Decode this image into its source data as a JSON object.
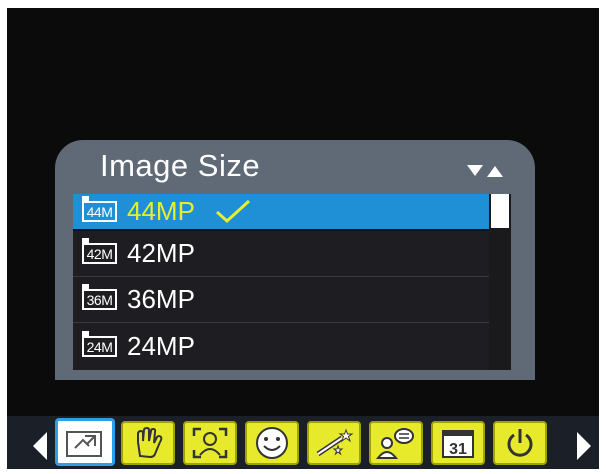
{
  "menu": {
    "title": "Image Size",
    "options": [
      {
        "badge": "44M",
        "label": "44MP",
        "selected": true
      },
      {
        "badge": "42M",
        "label": "42MP",
        "selected": false
      },
      {
        "badge": "36M",
        "label": "36MP",
        "selected": false
      },
      {
        "badge": "24M",
        "label": "24MP",
        "selected": false
      }
    ]
  },
  "toolbar": {
    "items": [
      {
        "icon": "photo-settings-icon",
        "active": true
      },
      {
        "icon": "hand-icon",
        "active": false
      },
      {
        "icon": "face-frame-icon",
        "active": false
      },
      {
        "icon": "smile-icon",
        "active": false
      },
      {
        "icon": "magic-wand-icon",
        "active": false
      },
      {
        "icon": "person-chat-icon",
        "active": false
      },
      {
        "icon": "calendar-icon",
        "active": false,
        "text": "31"
      },
      {
        "icon": "power-icon",
        "active": false
      }
    ]
  },
  "colors": {
    "selection": "#1f8fd6",
    "selected_text": "#e8ee2c",
    "toolbar_icon": "#e6ea2a",
    "panel": "#5f6a76"
  }
}
